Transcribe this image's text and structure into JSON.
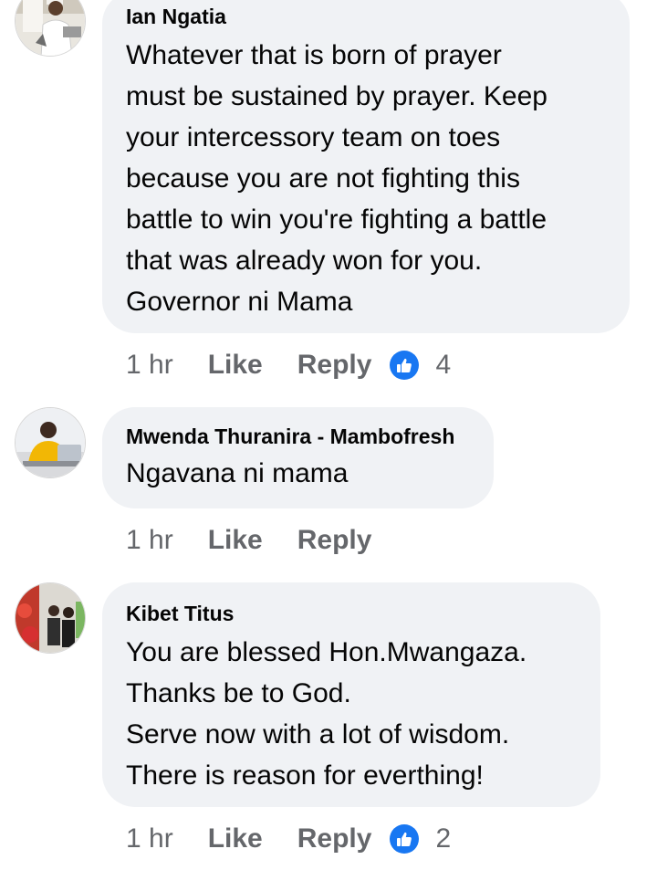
{
  "comments": [
    {
      "author": "Ian Ngatia",
      "lines": [
        "Whatever that is born of prayer",
        "must be sustained by prayer. Keep",
        "your intercessory team on toes",
        "because you are not fighting this",
        "battle to win you're fighting a battle",
        "that was already won for you.",
        "Governor ni Mama"
      ],
      "time": "1 hr",
      "like_label": "Like",
      "reply_label": "Reply",
      "reactions": "4"
    },
    {
      "author": "Mwenda Thuranira - Mambofresh",
      "lines": [
        "Ngavana ni mama"
      ],
      "time": "1 hr",
      "like_label": "Like",
      "reply_label": "Reply"
    },
    {
      "author": "Kibet Titus",
      "lines": [
        "You are blessed Hon.Mwangaza.",
        "Thanks be to God.",
        "Serve now with a lot of wisdom.",
        "There is reason for everthing!"
      ],
      "time": "1 hr",
      "like_label": "Like",
      "reply_label": "Reply",
      "reactions": "2"
    }
  ],
  "colors": {
    "bubble": "#f0f2f5",
    "meta_text": "#65676b",
    "like_badge": "#1877f2"
  },
  "icons": {
    "reaction": "thumbs-up-icon"
  }
}
